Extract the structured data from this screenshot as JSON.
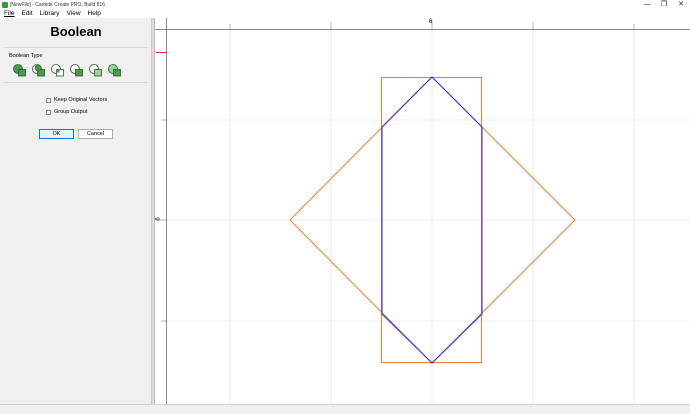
{
  "window": {
    "title": "[NewFile] - Carbide Create PRO, Build 816",
    "controls": [
      "—",
      "❐",
      "✕"
    ]
  },
  "menu": [
    "File",
    "Edit",
    "Library",
    "View",
    "Help"
  ],
  "panel": {
    "heading": "Boolean",
    "boolean_type_label": "Boolean Type",
    "icons": [
      "union-icon",
      "subtract-icon",
      "intersect-icon",
      "subtract-reverse-icon",
      "exclude-icon",
      "clip-icon"
    ],
    "keep_original_vectors": {
      "label": "Keep Original Vectors",
      "checked": false
    },
    "group_output": {
      "label": "Group Output",
      "checked": false
    },
    "ok_label": "OK",
    "cancel_label": "Cancel"
  },
  "rulers": {
    "h_label": "6",
    "v_label": "6"
  },
  "colors": {
    "orange_shape": "#f07b2a",
    "blue_shape": "#2a2aff",
    "grid": "#dcdcdc",
    "accent": "#0078d7"
  }
}
